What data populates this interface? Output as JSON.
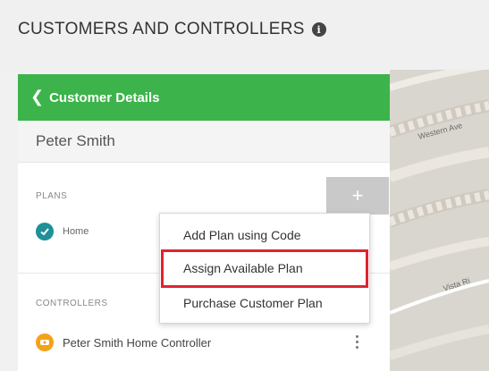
{
  "page": {
    "title": "CUSTOMERS AND CONTROLLERS",
    "info_icon": "i"
  },
  "panel": {
    "back_label": "Customer Details",
    "customer_name": "Peter Smith",
    "plans_label": "PLANS",
    "add_button_icon": "+",
    "plan_name": "Home",
    "controllers_label": "CONTROLLERS",
    "controller_name": "Peter Smith Home Controller"
  },
  "menu": {
    "items": [
      {
        "label": "Add Plan using Code"
      },
      {
        "label": "Assign Available Plan",
        "highlighted": true
      },
      {
        "label": "Purchase Customer Plan"
      }
    ]
  },
  "map": {
    "labels": [
      "Western Ave",
      "Vista Ri"
    ]
  },
  "colors": {
    "header_green": "#3cb44b",
    "check_teal": "#1f8f98",
    "controller_orange": "#f3a21b",
    "highlight_red": "#e0242f"
  }
}
